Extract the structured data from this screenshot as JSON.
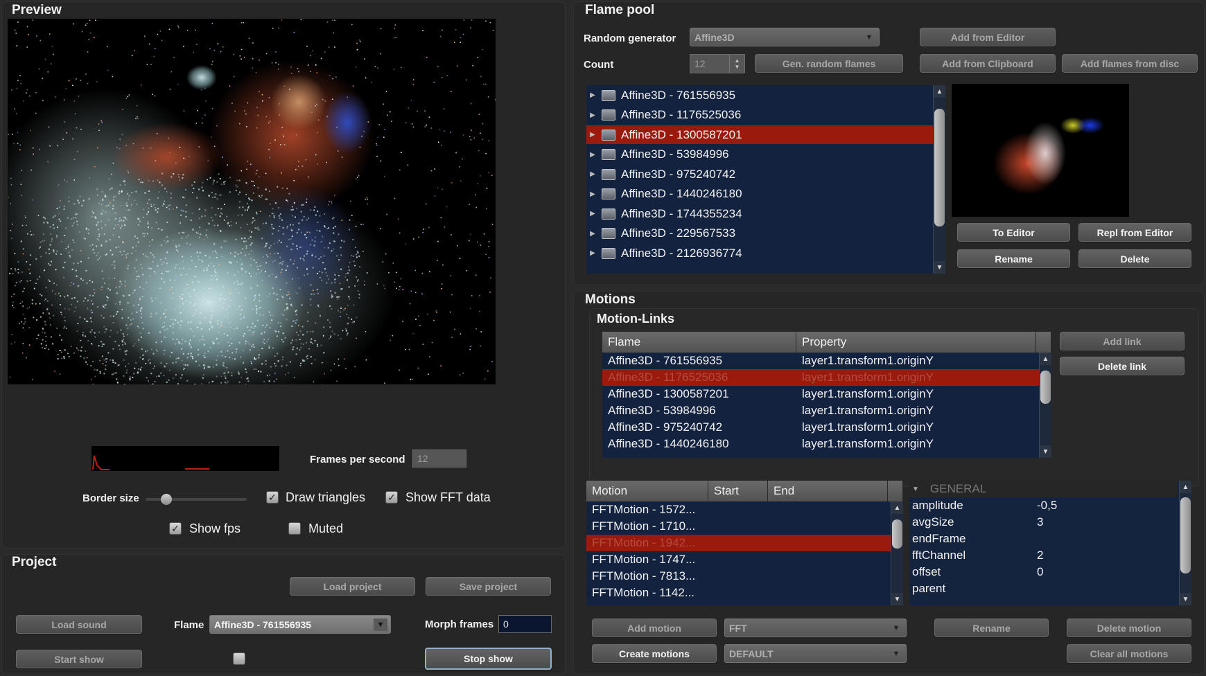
{
  "preview": {
    "title": "Preview",
    "frames_per_second_label": "Frames per second",
    "frames_per_second_value": "12",
    "border_size_label": "Border size",
    "border_size_level": 0.2,
    "draw_triangles_label": "Draw triangles",
    "draw_triangles_checked": true,
    "show_fft_label": "Show FFT data",
    "show_fft_checked": true,
    "show_fps_label": "Show fps",
    "show_fps_checked": true,
    "muted_label": "Muted",
    "muted_checked": false
  },
  "project": {
    "title": "Project",
    "load_project": "Load project",
    "save_project": "Save project",
    "load_sound": "Load sound",
    "flame_label": "Flame",
    "flame_value": "Affine3D - 761556935",
    "morph_frames_label": "Morph frames",
    "morph_frames_value": "0",
    "start_show": "Start show",
    "stop_show": "Stop show"
  },
  "flame_pool": {
    "title": "Flame pool",
    "random_generator_label": "Random generator",
    "random_generator_value": "Affine3D",
    "count_label": "Count",
    "count_value": "12",
    "gen_random_flames": "Gen. random flames",
    "add_from_editor": "Add from Editor",
    "add_from_clipboard": "Add from Clipboard",
    "add_flames_from_disc": "Add flames from disc",
    "items": [
      "Affine3D - 761556935",
      "Affine3D - 1176525036",
      "Affine3D - 1300587201",
      "Affine3D - 53984996",
      "Affine3D - 975240742",
      "Affine3D - 1440246180",
      "Affine3D - 1744355234",
      "Affine3D - 229567533",
      "Affine3D - 2126936774"
    ],
    "selected_index": 2,
    "to_editor": "To Editor",
    "repl_from_editor": "Repl from Editor",
    "rename": "Rename",
    "delete": "Delete"
  },
  "motions": {
    "title": "Motions",
    "links_title": "Motion-Links",
    "links_headers": [
      "Flame",
      "Property"
    ],
    "links_rows": [
      [
        "Affine3D - 761556935",
        "layer1.transform1.originY"
      ],
      [
        "Affine3D - 1176525036",
        "layer1.transform1.originY"
      ],
      [
        "Affine3D - 1300587201",
        "layer1.transform1.originY"
      ],
      [
        "Affine3D - 53984996",
        "layer1.transform1.originY"
      ],
      [
        "Affine3D - 975240742",
        "layer1.transform1.originY"
      ],
      [
        "Affine3D - 1440246180",
        "layer1.transform1.originY"
      ]
    ],
    "links_selected_index": 1,
    "add_link": "Add link",
    "delete_link": "Delete link",
    "motion_headers": [
      "Motion",
      "Start",
      "End"
    ],
    "motion_rows": [
      "FFTMotion - 1572...",
      "FFTMotion - 1710...",
      "FFTMotion - 1942...",
      "FFTMotion - 1747...",
      "FFTMotion - 7813...",
      "FFTMotion - 1142..."
    ],
    "motion_selected_index": 2,
    "general_label": "GENERAL",
    "properties": [
      [
        "amplitude",
        "-0,5"
      ],
      [
        "avgSize",
        "3"
      ],
      [
        "endFrame",
        ""
      ],
      [
        "fftChannel",
        "2"
      ],
      [
        "offset",
        "0"
      ],
      [
        "parent",
        ""
      ]
    ],
    "add_motion": "Add motion",
    "motion_type": "FFT",
    "rename": "Rename",
    "delete_motion": "Delete motion",
    "create_motions": "Create motions",
    "create_mode": "DEFAULT",
    "clear_all_motions": "Clear all motions"
  },
  "colors": {
    "selection": "#9a1a0e",
    "list_bg": "#13233f",
    "panel_bg": "#262626"
  }
}
